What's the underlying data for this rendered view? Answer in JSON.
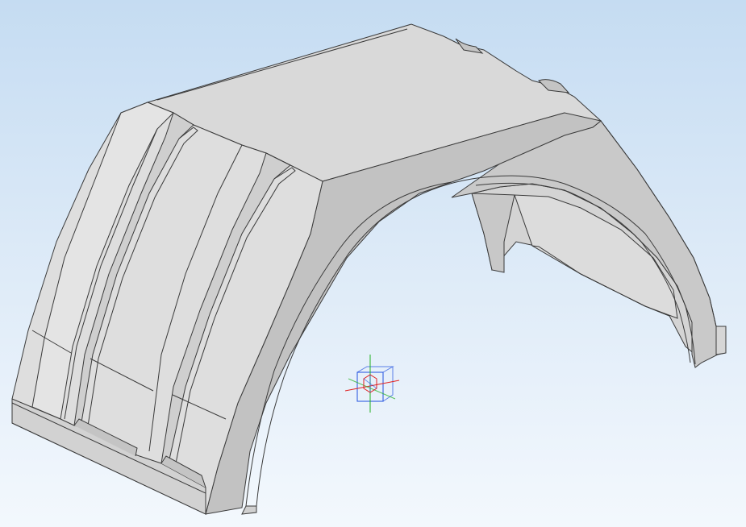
{
  "viewport": {
    "background_top": "#c5dcf2",
    "background_bottom": "#f3f8fd"
  },
  "model": {
    "icon": "fender-3d-model",
    "shade_light": "#e2e2e2",
    "shade_mid": "#d3d3d3",
    "shade_dark": "#b9b9b9",
    "edge_color": "#3a3a3a"
  },
  "triad": {
    "icon": "coordinate-triad-icon",
    "axis_x_color": "#e02020",
    "axis_y_color": "#20b020",
    "axis_z_color": "#2050e0"
  }
}
